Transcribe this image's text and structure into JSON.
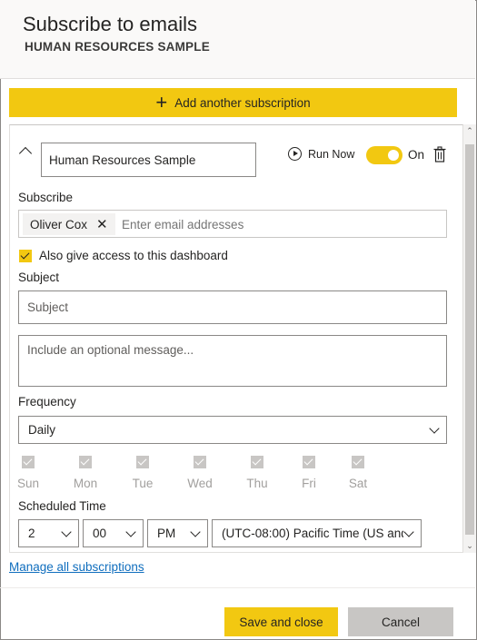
{
  "header": {
    "title": "Subscribe to emails",
    "subtitle": "HUMAN RESOURCES SAMPLE"
  },
  "add_subscription": {
    "label": "Add another subscription",
    "icon": "plus-icon"
  },
  "subscription": {
    "name": "Human Resources Sample",
    "run_now_label": "Run Now",
    "toggle_label": "On",
    "toggle_on": true,
    "subscribe_label": "Subscribe",
    "recipients": [
      "Oliver Cox"
    ],
    "email_placeholder": "Enter email addresses",
    "give_access_label": "Also give access to this dashboard",
    "give_access_checked": true,
    "subject_label": "Subject",
    "subject_placeholder": "Subject",
    "message_placeholder": "Include an optional message...",
    "frequency_label": "Frequency",
    "frequency_value": "Daily",
    "days": [
      {
        "label": "Sun",
        "checked": true
      },
      {
        "label": "Mon",
        "checked": true
      },
      {
        "label": "Tue",
        "checked": true
      },
      {
        "label": "Wed",
        "checked": true
      },
      {
        "label": "Thu",
        "checked": true
      },
      {
        "label": "Fri",
        "checked": true
      },
      {
        "label": "Sat",
        "checked": true
      }
    ],
    "scheduled_time_label": "Scheduled Time",
    "hour": "2",
    "minute": "00",
    "ampm": "PM",
    "timezone": "(UTC-08:00) Pacific Time (US and C"
  },
  "manage_link": "Manage all subscriptions",
  "footer": {
    "save_label": "Save and close",
    "cancel_label": "Cancel"
  },
  "colors": {
    "accent": "#f2c811",
    "link": "#106ebe",
    "disabled_check": "#c8c6c4"
  }
}
